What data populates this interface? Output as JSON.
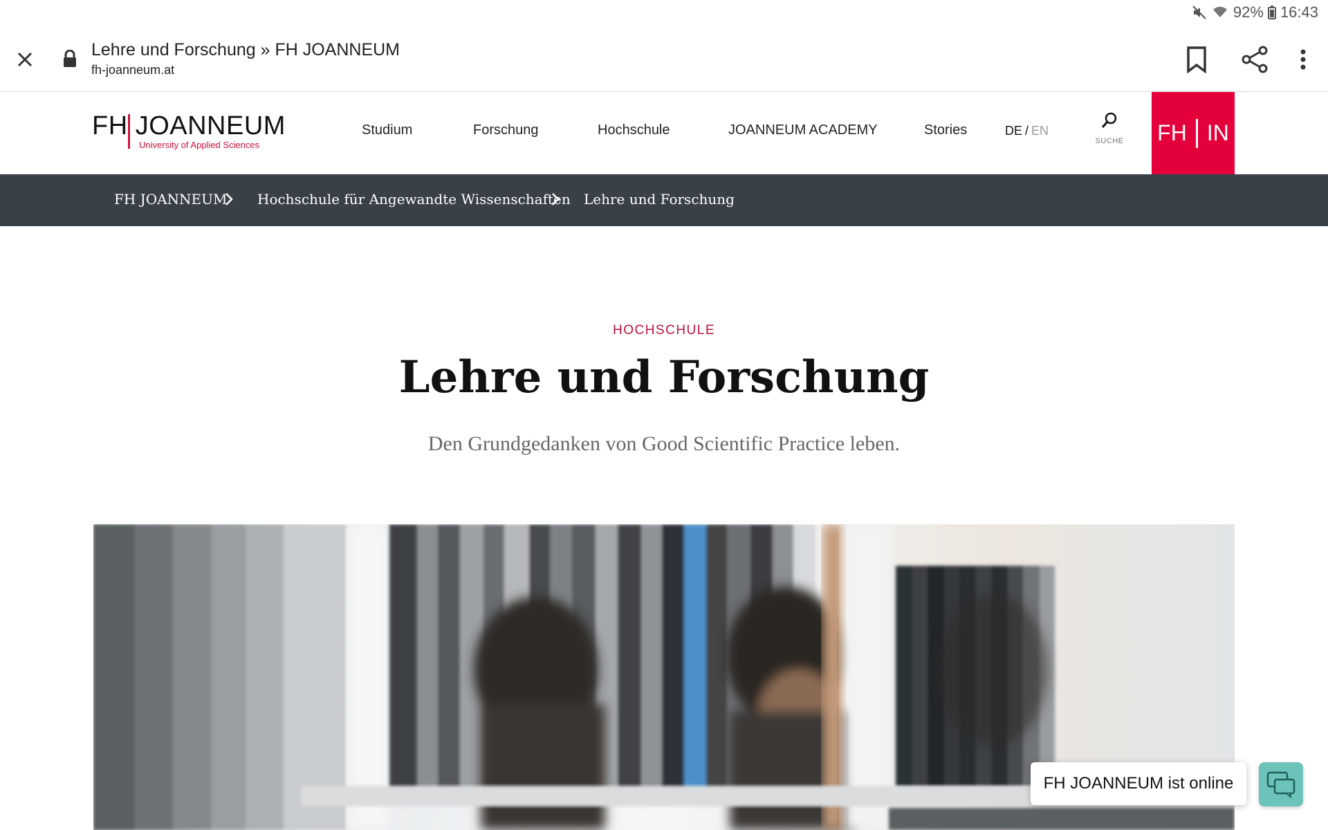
{
  "status_bar": {
    "battery": "92%",
    "time": "16:43"
  },
  "browser": {
    "title": "Lehre und Forschung » FH JOANNEUM",
    "url": "fh-joanneum.at"
  },
  "site": {
    "logo": {
      "main": "FH JOANNEUM",
      "subtitle": "University of Applied Sciences"
    },
    "nav": [
      "Studium",
      "Forschung",
      "Hochschule",
      "JOANNEUM ACADEMY",
      "Stories"
    ],
    "lang": {
      "de": "DE",
      "separator": "/",
      "en": "EN"
    },
    "search_label": "SUCHE",
    "fhin_left": "FH",
    "fhin_right": "IN"
  },
  "breadcrumb": [
    "FH JOANNEUM",
    "Hochschule für Angewandte Wissenschaften",
    "Lehre und Forschung"
  ],
  "hero": {
    "kicker": "HOCHSCHULE",
    "headline": "Lehre und Forschung",
    "subline": "Den Grundgedanken von Good Scientific Practice leben."
  },
  "chat": {
    "label": "FH JOANNEUM ist online"
  },
  "colors": {
    "brand_red": "#e4003a",
    "breadcrumb_bg": "#3a4048",
    "chat_accent": "#6cc3b9"
  }
}
